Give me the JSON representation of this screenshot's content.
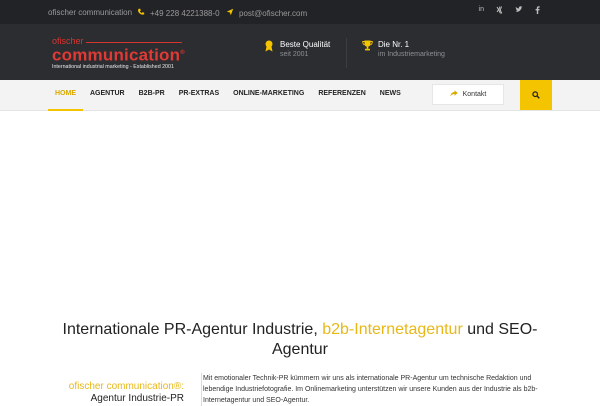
{
  "topbar": {
    "company": "ofischer communication",
    "phone": "+49 228 4221388-0",
    "email": "post@ofischer.com",
    "social": [
      "in",
      "xing",
      "twitter",
      "facebook"
    ]
  },
  "logo": {
    "line1": "ofischer",
    "line2": "communication",
    "reg": "®",
    "tagline": "International industrial marketing - Established 2001"
  },
  "features": [
    {
      "title": "Beste Qualität",
      "subtitle": "seit 2001",
      "icon": "award-icon"
    },
    {
      "title": "Die Nr. 1",
      "subtitle": "im Industriemarketing",
      "icon": "trophy-icon"
    }
  ],
  "nav": {
    "items": [
      "HOME",
      "AGENTUR",
      "B2B-PR",
      "PR-EXTRAS",
      "ONLINE-MARKETING",
      "REFERENZEN",
      "NEWS"
    ],
    "active": "HOME",
    "contact_label": "Kontakt"
  },
  "headline": {
    "part1": "Internationale PR-Agentur Industrie, ",
    "highlight": "b2b-Internetagentur",
    "part2": " und SEO-Agentur"
  },
  "intro": {
    "left_title": "ofischer communication®:",
    "left_sub": "Agentur Industrie-PR",
    "text": "Mit emotionaler Technik-PR kümmern wir uns als internationale PR-Agentur um technische Redaktion und lebendige Industriefotografie. Im Onlinemarketing unterstützen wir unsere Kunden aus der Industrie als b2b-Internetagentur und SEO-Agentur."
  },
  "colors": {
    "accent": "#f5c400",
    "brand_red": "#e03a34",
    "topbar_bg": "#222326",
    "header_bg": "#2b2d31"
  }
}
